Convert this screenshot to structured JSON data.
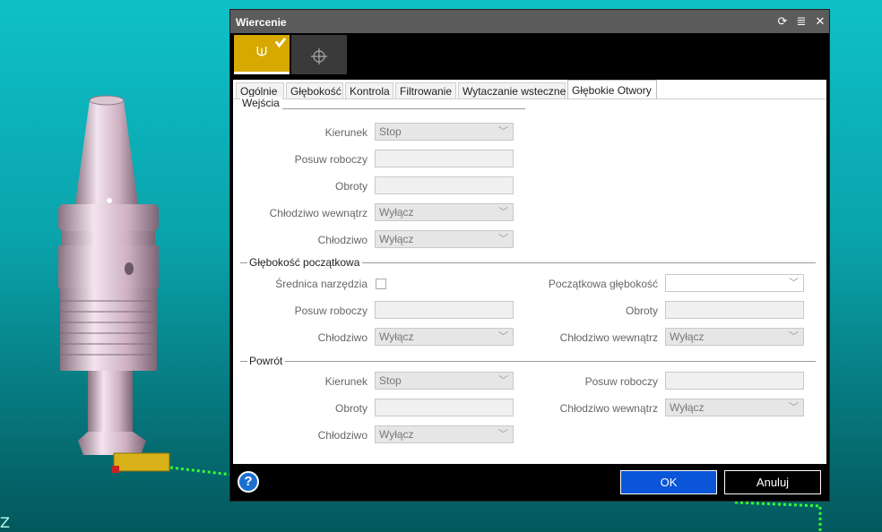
{
  "viewport": {
    "axis_label": "Z"
  },
  "dialog": {
    "title": "Wiercenie",
    "controls": {
      "refresh": "⟳",
      "menu": "≣",
      "close": "✕"
    },
    "tabs": [
      {
        "label": "Ogólnie"
      },
      {
        "label": "Głębokość"
      },
      {
        "label": "Kontrola"
      },
      {
        "label": "Filtrowanie"
      },
      {
        "label": "Wytaczanie wsteczne"
      },
      {
        "label": "Głębokie Otwory"
      }
    ],
    "active_tab": "Głębokie Otwory",
    "sections": {
      "wejscia": {
        "title": "Wejścia",
        "kierunek_label": "Kierunek",
        "kierunek_value": "Stop",
        "posuw_label": "Posuw roboczy",
        "posuw_value": "",
        "obroty_label": "Obroty",
        "obroty_value": "",
        "chlodziwo_wew_label": "Chłodziwo wewnątrz",
        "chlodziwo_wew_value": "Wyłącz",
        "chlodziwo_label": "Chłodziwo",
        "chlodziwo_value": "Wyłącz"
      },
      "glebokosc_poczatkowa": {
        "title": "Głębokość początkowa",
        "srednica_label": "Średnica narzędzia",
        "posuw_label": "Posuw roboczy",
        "posuw_value": "",
        "chlodziwo_label": "Chłodziwo",
        "chlodziwo_value": "Wyłącz",
        "pocz_gleb_label": "Początkowa głębokość",
        "pocz_gleb_value": "",
        "obroty_label": "Obroty",
        "obroty_value": "",
        "chlodziwo_wew_label": "Chłodziwo wewnątrz",
        "chlodziwo_wew_value": "Wyłącz"
      },
      "powrot": {
        "title": "Powrót",
        "kierunek_label": "Kierunek",
        "kierunek_value": "Stop",
        "obroty_label": "Obroty",
        "obroty_value": "",
        "chlodziwo_label": "Chłodziwo",
        "chlodziwo_value": "Wyłącz",
        "posuw_label": "Posuw roboczy",
        "posuw_value": "",
        "chlodziwo_wew_label": "Chłodziwo wewnątrz",
        "chlodziwo_wew_value": "Wyłącz"
      }
    },
    "footer": {
      "help": "?",
      "ok": "OK",
      "cancel": "Anuluj"
    }
  },
  "colors": {
    "accent_yellow": "#d6a800",
    "ok_blue": "#0a55d8",
    "viewport_cyan": "#0fc0c8"
  }
}
